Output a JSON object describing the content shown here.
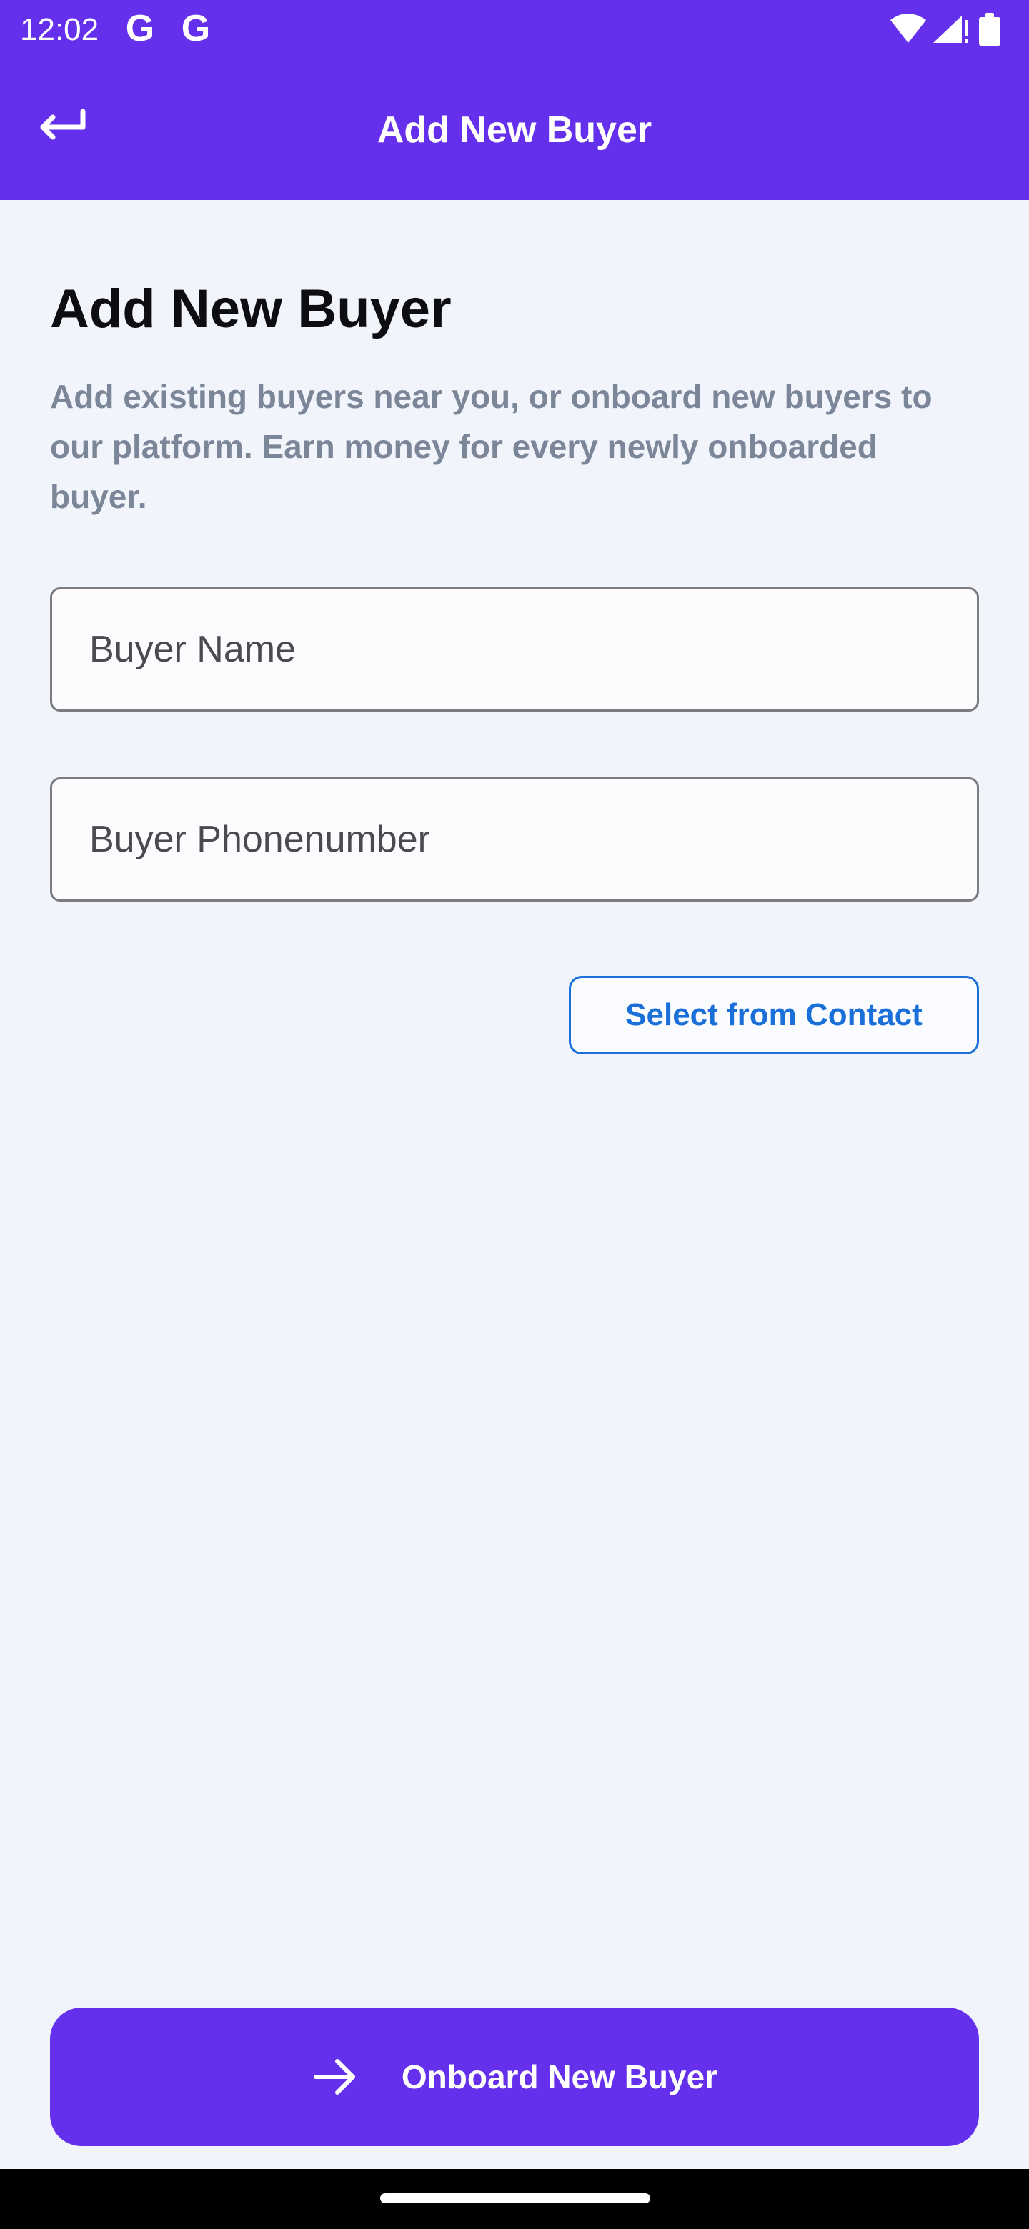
{
  "status_bar": {
    "time": "12:02",
    "left_icons": [
      "google-icon",
      "google-icon"
    ],
    "right_icons": [
      "wifi-icon",
      "signal-icon",
      "battery-icon"
    ]
  },
  "app_bar": {
    "back_icon": "back-arrow-icon",
    "title": "Add New Buyer"
  },
  "content": {
    "heading": "Add New Buyer",
    "description": "Add existing buyers near you, or onboard new buyers to our platform. Earn money for every newly onboarded buyer."
  },
  "form": {
    "buyer_name": {
      "value": "",
      "placeholder": "Buyer Name"
    },
    "buyer_phone": {
      "value": "",
      "placeholder": "Buyer Phonenumber"
    },
    "select_contact_label": "Select from Contact"
  },
  "footer": {
    "onboard_label": "Onboard New Buyer",
    "onboard_icon": "arrow-right-icon"
  },
  "colors": {
    "primary": "#6530ec",
    "link": "#1a6fd8",
    "background": "#f1f5fb",
    "description_text": "#7b8699"
  }
}
